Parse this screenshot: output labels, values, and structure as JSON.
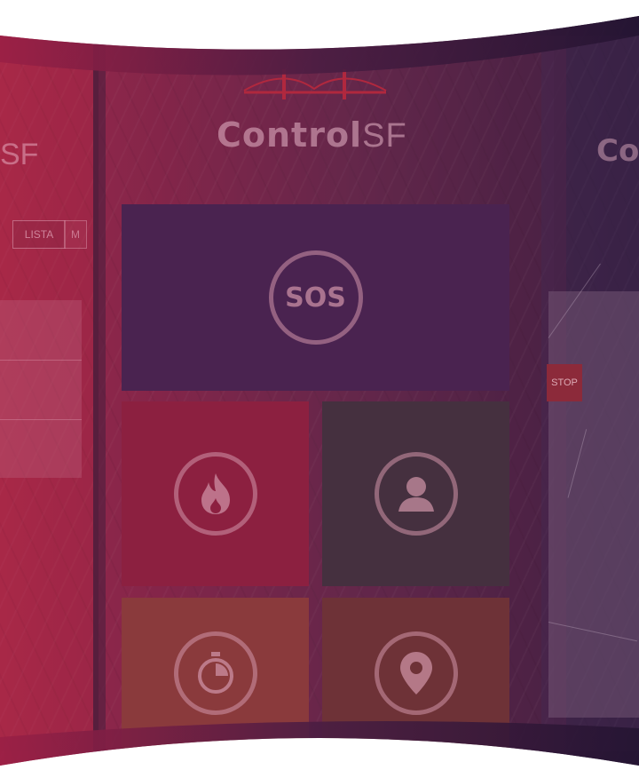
{
  "center_screen": {
    "logo_bold": "Control",
    "logo_light": "SF",
    "tiles": {
      "sos_label": "SOS",
      "fire_icon": "fire-icon",
      "user_icon": "user-icon",
      "timer_icon": "stopwatch-icon",
      "location_icon": "location-pin-icon"
    }
  },
  "left_screen": {
    "logo_partial": "SF",
    "list_button": "LISTA",
    "second_button": "M"
  },
  "right_screen": {
    "logo_partial": "Co",
    "stop_label": "STOP"
  },
  "colors": {
    "gradient_left": "#b02848",
    "gradient_right": "#2b1b3a",
    "sos_tile": "#4a2350",
    "fire_tile": "#8c2040",
    "user_tile": "#45303f",
    "timer_tile": "#8a3a3c",
    "location_tile": "#6e3237"
  }
}
